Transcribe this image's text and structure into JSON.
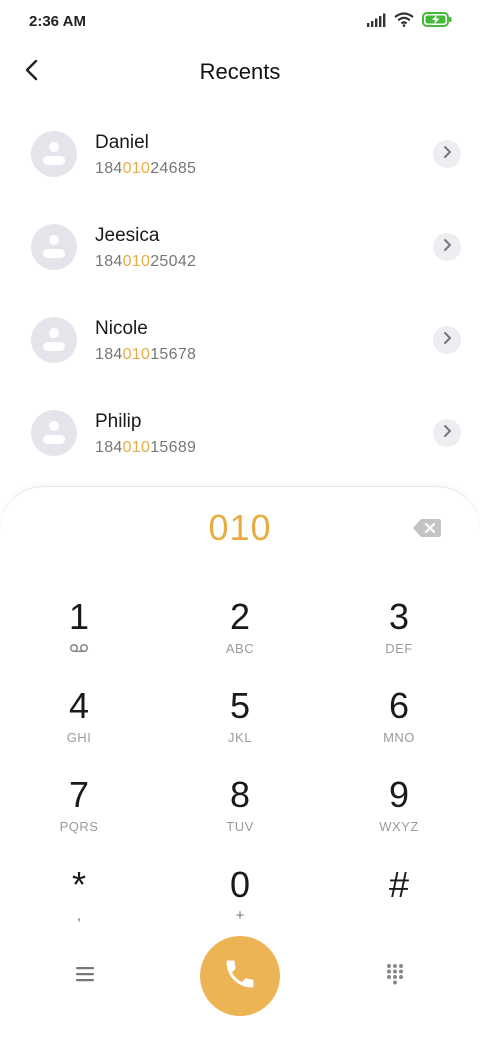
{
  "status_bar": {
    "time": "2:36 AM",
    "icons": [
      "signal-icon",
      "wifi-icon",
      "battery-charging-icon"
    ],
    "battery_color": "#46b83a"
  },
  "header": {
    "title": "Recents",
    "back_icon": "back-arrow-icon"
  },
  "recents": [
    {
      "name": "Daniel",
      "number_pre": "184",
      "number_match": "010",
      "number_post": "24685"
    },
    {
      "name": "Jeesica",
      "number_pre": "184",
      "number_match": "010",
      "number_post": "25042"
    },
    {
      "name": "Nicole",
      "number_pre": "184",
      "number_match": "010",
      "number_post": "15678"
    },
    {
      "name": "Philip",
      "number_pre": "184",
      "number_match": "010",
      "number_post": "15689"
    }
  ],
  "dialpad": {
    "input": "010",
    "accent_color": "#e8ac44",
    "keys": [
      {
        "digit": "1",
        "letters": ""
      },
      {
        "digit": "2",
        "letters": "ABC"
      },
      {
        "digit": "3",
        "letters": "DEF"
      },
      {
        "digit": "4",
        "letters": "GHI"
      },
      {
        "digit": "5",
        "letters": "JKL"
      },
      {
        "digit": "6",
        "letters": "MNO"
      },
      {
        "digit": "7",
        "letters": "PQRS"
      },
      {
        "digit": "8",
        "letters": "TUV"
      },
      {
        "digit": "9",
        "letters": "WXYZ"
      },
      {
        "digit": "*",
        "letters": ","
      },
      {
        "digit": "0",
        "letters": "+"
      },
      {
        "digit": "#",
        "letters": ""
      }
    ],
    "key1_icon": "voicemail-icon",
    "bottom_icons": [
      "menu-icon",
      "phone-icon",
      "keypad-icon"
    ]
  }
}
